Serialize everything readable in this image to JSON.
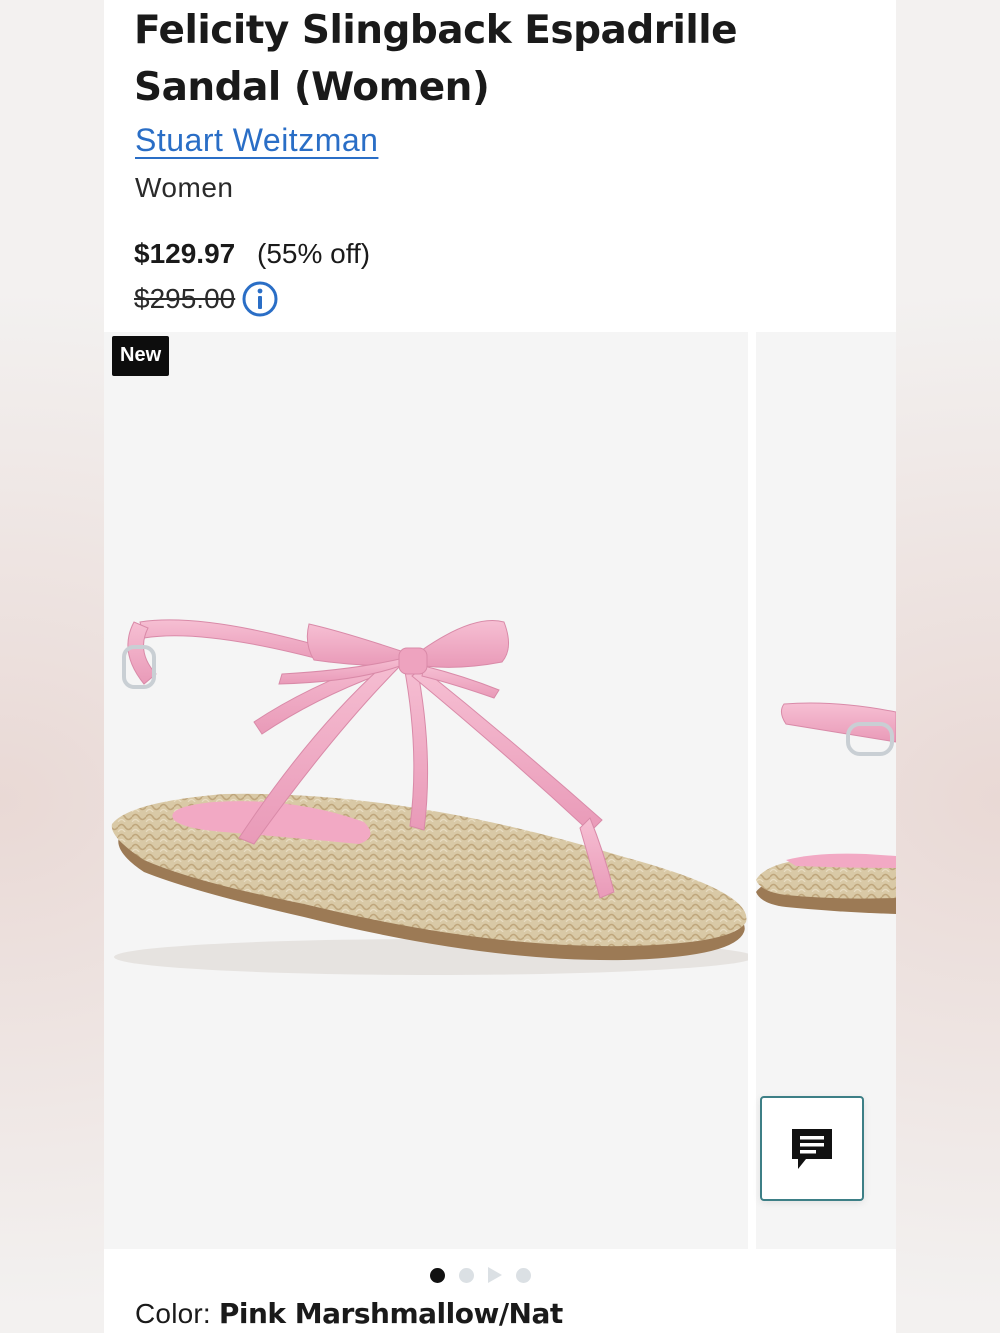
{
  "product": {
    "title": "Felicity Slingback Espadrille Sandal (Women)",
    "brand": "Stuart Weitzman",
    "category": "Women",
    "price": {
      "sale": "$129.97",
      "discount": "(55% off)",
      "original": "$295.00"
    }
  },
  "gallery": {
    "badge": "New",
    "image_subject": "pink bow thong sandal with espadrille sole",
    "dots": {
      "count": 4,
      "active_index": 0,
      "video_index": 2
    }
  },
  "color": {
    "label": "Color:",
    "value": "Pink Marshmallow/Nat"
  },
  "icons": {
    "info": "info-circle-icon",
    "chat": "chat-bubble-icon"
  },
  "colors": {
    "brand_link": "#2a6ec6",
    "chat_border": "#3d7f86",
    "sandal_pink": "#f0a9c3",
    "jute": "#d8c7a2",
    "badge_bg": "#0d0d0d"
  }
}
